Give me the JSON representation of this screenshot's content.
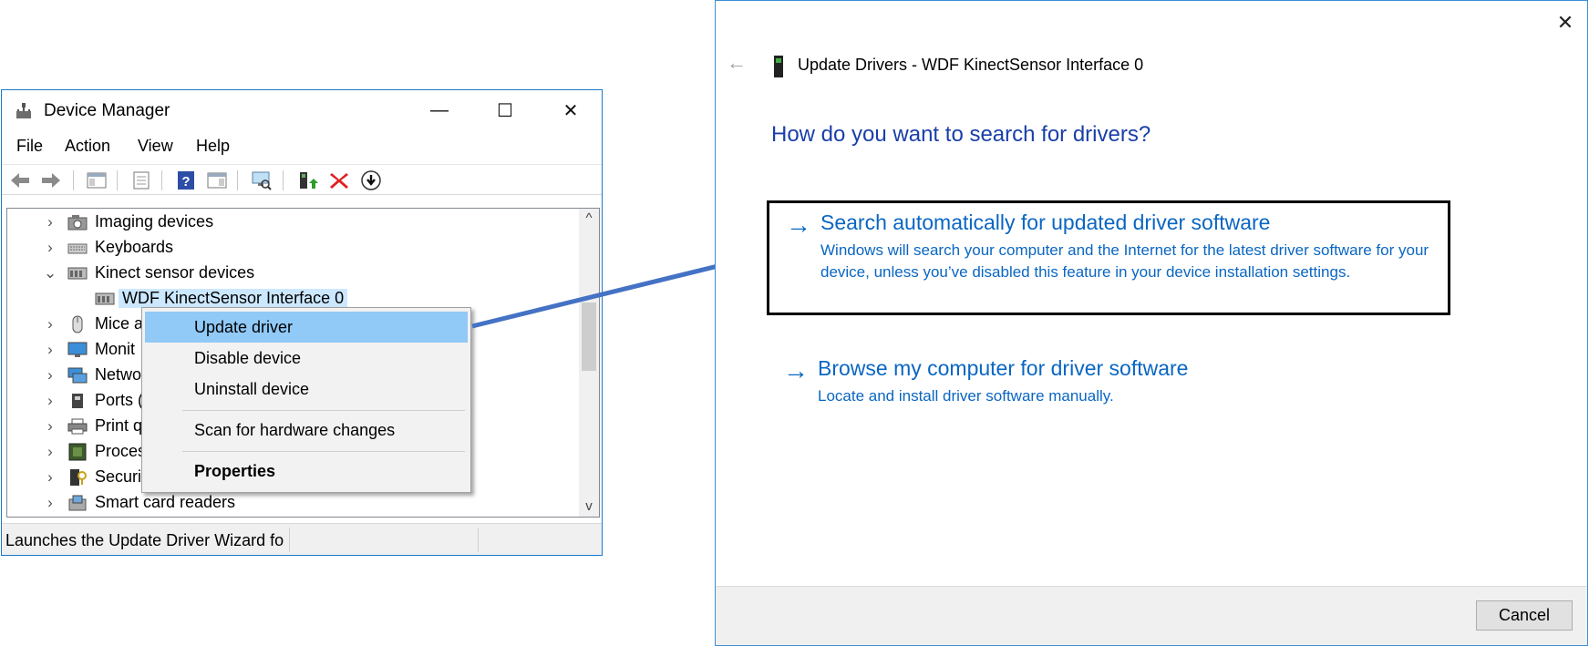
{
  "device_manager": {
    "title": "Device Manager",
    "window_controls": {
      "minimize": "—",
      "maximize": "☐",
      "close": "✕"
    },
    "menu": [
      "File",
      "Action",
      "View",
      "Help"
    ],
    "tree": [
      {
        "chevron": "›",
        "label": "Imaging devices",
        "icon": "imaging-device-icon"
      },
      {
        "chevron": "›",
        "label": "Keyboards",
        "icon": "keyboard-icon"
      },
      {
        "chevron": "⌄",
        "label": "Kinect sensor devices",
        "icon": "kinect-sensor-icon"
      },
      {
        "chevron": "",
        "label": "WDF KinectSensor Interface 0",
        "icon": "kinect-sensor-icon",
        "selected": true
      },
      {
        "chevron": "›",
        "label": "Mice a",
        "icon": "mouse-icon"
      },
      {
        "chevron": "›",
        "label": "Monit",
        "icon": "monitor-icon"
      },
      {
        "chevron": "›",
        "label": "Netwo",
        "icon": "network-icon"
      },
      {
        "chevron": "›",
        "label": "Ports (",
        "icon": "port-icon"
      },
      {
        "chevron": "›",
        "label": "Print q",
        "icon": "printer-icon"
      },
      {
        "chevron": "›",
        "label": "Proces",
        "icon": "processor-icon"
      },
      {
        "chevron": "›",
        "label": "Securit",
        "icon": "security-icon"
      },
      {
        "chevron": "›",
        "label": "Smart card readers",
        "icon": "smart-card-icon"
      }
    ],
    "scroll": {
      "up": "^",
      "down": "v"
    },
    "status_text": "Launches the Update Driver Wizard fo",
    "context_menu": {
      "update_driver": "Update driver",
      "disable_device": "Disable device",
      "uninstall_device": "Uninstall device",
      "scan": "Scan for hardware changes",
      "properties": "Properties"
    }
  },
  "update_dialog": {
    "close": "✕",
    "back": "←",
    "header": "Update Drivers - WDF KinectSensor Interface 0",
    "question": "How do you want to search for drivers?",
    "option_auto": {
      "arrow": "→",
      "title": "Search automatically for updated driver software",
      "desc": "Windows will search your computer and the Internet for the latest driver software for your device, unless you’ve disabled this feature in your device installation settings."
    },
    "option_browse": {
      "arrow": "→",
      "title": "Browse my computer for driver software",
      "desc": "Locate and install driver software manually."
    },
    "cancel_label": "Cancel"
  },
  "colors": {
    "link_blue": "#0a66c2",
    "heading_blue": "#1a3fa8",
    "context_hover": "#91c9f7",
    "arrow": "#4472c4"
  }
}
